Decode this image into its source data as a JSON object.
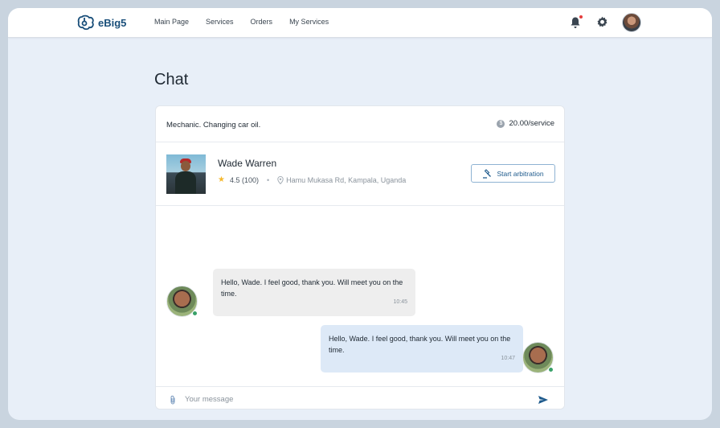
{
  "header": {
    "logo_text": "eBig5",
    "nav": [
      "Main Page",
      "Services",
      "Orders",
      "My Services"
    ],
    "icons": [
      "bell-icon",
      "gear-icon"
    ],
    "notification_dot_color": "#e53e3e"
  },
  "page": {
    "title": "Chat"
  },
  "card": {
    "service_title": "Mechanic. Changing car oil.",
    "price": "20.00/service",
    "profile": {
      "name": "Wade Warren",
      "rating": "4.5 (100)",
      "location": "Hamu Mukasa Rd, Kampala, Uganda"
    },
    "arbitration_label": "Start arbitration"
  },
  "messages": [
    {
      "direction": "incoming",
      "text": "Hello, Wade. I feel good, thank you. Will meet you on the time.",
      "time": "10:45"
    },
    {
      "direction": "outgoing",
      "text": "Hello, Wade. I feel good, thank you. Will meet you on the time.",
      "time": "10:47"
    }
  ],
  "composer": {
    "placeholder": "Your message"
  },
  "colors": {
    "accent": "#1e5a8c",
    "star": "#f5b82e",
    "online": "#38a169",
    "incoming_bubble": "#eeeeee",
    "outgoing_bubble": "#dde9f7"
  }
}
